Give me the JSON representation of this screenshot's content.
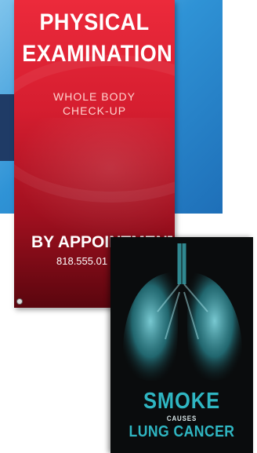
{
  "red_banner": {
    "title_line1": "PHYSICAL",
    "title_line2": "EXAMINATION",
    "subtitle_line1": "WHOLE BODY",
    "subtitle_line2": "CHECK-UP",
    "appointment": "BY APPOINTMENT",
    "phone": "818.555.01"
  },
  "dark_banner": {
    "title_line1": "SMOKE",
    "connector": "CAUSES",
    "title_line2": "LUNG CANCER"
  },
  "colors": {
    "background_blue": "#2f93d6",
    "banner_red": "#d61e30",
    "banner_dark": "#0a0c0d",
    "accent_teal": "#2fb6c2"
  }
}
